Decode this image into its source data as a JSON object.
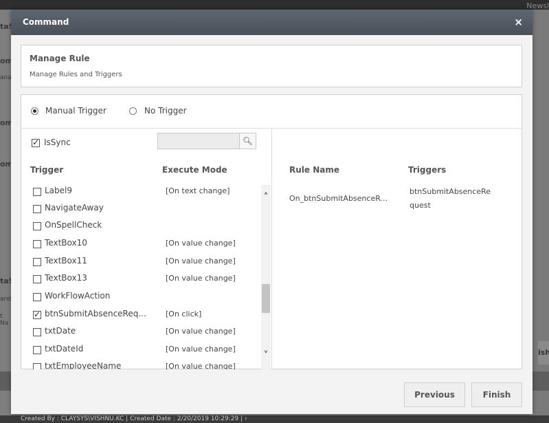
{
  "background": {
    "top_right": "Newsl",
    "left_labels": [
      "taS",
      "om",
      "ana",
      "om",
      "om",
      "taS",
      "areF",
      "t Na"
    ],
    "right_button": "ish",
    "footer_text": "Created By : CLAYSYS\\VISHNU.KC | Created Date : 2/20/2019 10:29:29  |  ›"
  },
  "modal": {
    "title": "Command",
    "close_glyph": "×"
  },
  "info": {
    "title": "Manage Rule",
    "subtitle": "Manage Rules and Triggers"
  },
  "trigger_options": [
    {
      "label": "Manual Trigger",
      "selected": true
    },
    {
      "label": "No Trigger",
      "selected": false
    }
  ],
  "issync": {
    "label": "IsSync",
    "checked": true
  },
  "search": {
    "value": "",
    "placeholder": "",
    "icon": "search-icon"
  },
  "trigger_table": {
    "headers": {
      "trigger": "Trigger",
      "mode": "Execute Mode"
    },
    "rows": [
      {
        "name": "Label9",
        "mode": "[On text change]",
        "checked": false
      },
      {
        "name": "NavigateAway",
        "mode": "",
        "checked": false
      },
      {
        "name": "OnSpellCheck",
        "mode": "",
        "checked": false
      },
      {
        "name": "TextBox10",
        "mode": "[On value change]",
        "checked": false
      },
      {
        "name": "TextBox11",
        "mode": "[On value change]",
        "checked": false
      },
      {
        "name": "TextBox13",
        "mode": "[On value change]",
        "checked": false
      },
      {
        "name": "WorkFlowAction",
        "mode": "",
        "checked": false
      },
      {
        "name": "btnSubmitAbsenceReq...",
        "mode": "[On click]",
        "checked": true
      },
      {
        "name": "txtDate",
        "mode": "[On value change]",
        "checked": false
      },
      {
        "name": "txtDateId",
        "mode": "[On value change]",
        "checked": false
      },
      {
        "name": "txtEmployeeName",
        "mode": "[On value change]",
        "checked": false
      }
    ]
  },
  "rules_table": {
    "headers": {
      "rule_name": "Rule Name",
      "triggers": "Triggers"
    },
    "rows": [
      {
        "rule_name": "On_btnSubmitAbsenceR...",
        "triggers_line1": "btnSubmitAbsenceRe",
        "triggers_line2": "quest"
      }
    ]
  },
  "buttons": {
    "previous": "Previous",
    "finish": "Finish"
  }
}
